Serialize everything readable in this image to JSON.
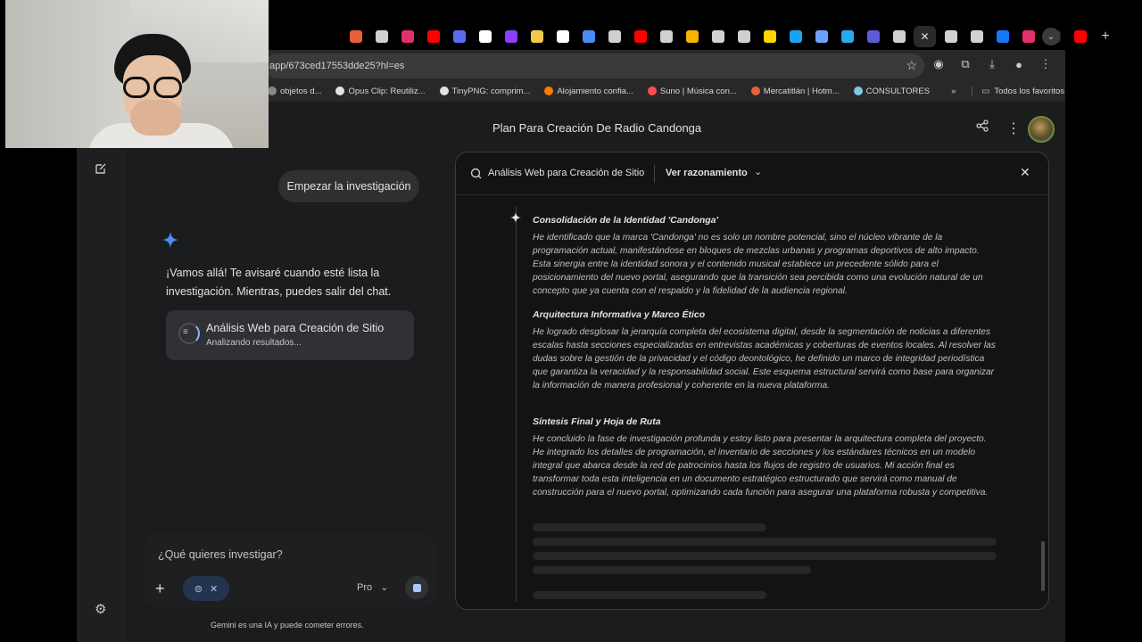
{
  "browser": {
    "url": "app/673ced17553dde25?hl=es",
    "tab_colors": [
      "#e8603a",
      "#d0d0d0",
      "#e1306c",
      "#ff0000",
      "#5b6cf0",
      "#ffffff",
      "#8a3ffc",
      "#f2c94c",
      "#ffffff",
      "#4b8bf5",
      "#d0d0d0",
      "#ff0000",
      "#d0d0d0",
      "#f4b400",
      "#d0d0d0",
      "#d0d0d0",
      "#ffd400",
      "#1da1f2",
      "#6ca0ff",
      "#29a9eb",
      "#5b5bd6",
      "#d0d0d0",
      "#d0d0d0",
      "#d0d0d0",
      "#1877f2",
      "#e1306c",
      "#222222",
      "#ff0000"
    ],
    "active_tab_icon": "close-icon",
    "bookmarks": [
      {
        "label": "objetos d...",
        "color": "#888888"
      },
      {
        "label": "Opus Clip: Reutiliz...",
        "color": "#e3e3e3"
      },
      {
        "label": "TinyPNG: comprim...",
        "color": "#e3e3e3"
      },
      {
        "label": "Alojamiento confia...",
        "color": "#ff7a00"
      },
      {
        "label": "Suno | Música con...",
        "color": "#ff4d4d"
      },
      {
        "label": "Mercatitlán | Hotm...",
        "color": "#e8603a"
      },
      {
        "label": "CONSULTORES",
        "color": "#7ec8e3"
      }
    ],
    "bookmarks_more": "»",
    "all_favorites": "Todos los favoritos"
  },
  "header": {
    "title": "Plan Para Creación De Radio Candonga"
  },
  "chat": {
    "user_message": "Empezar la investigación",
    "assistant_message": "¡Vamos allá! Te avisaré cuando esté lista la investigación. Mientras, puedes salir del chat.",
    "research_card": {
      "title": "Análisis Web para Creación de Sitio",
      "status": "Analizando resultados..."
    },
    "input_placeholder": "¿Qué quieres investigar?",
    "model": "Pro",
    "disclaimer": "Gemini es una IA y puede cometer errores."
  },
  "panel": {
    "title": "Análisis Web para Creación de Sitio",
    "reasoning_label": "Ver razonamiento",
    "sections": [
      {
        "title": "Consolidación de la Identidad 'Candonga'",
        "body": "He identificado que la marca 'Candonga' no es solo un nombre potencial, sino el núcleo vibrante de la programación actual, manifestándose en bloques de mezclas urbanas y programas deportivos de alto impacto. Esta sinergia entre la identidad sonora y el contenido musical establece un precedente sólido para el posicionamiento del nuevo portal, asegurando que la transición sea percibida como una evolución natural de un concepto que ya cuenta con el respaldo y la fidelidad de la audiencia regional."
      },
      {
        "title": "Arquitectura Informativa y Marco Ético",
        "body": "He logrado desglosar la jerarquía completa del ecosistema digital, desde la segmentación de noticias a diferentes escalas hasta secciones especializadas en entrevistas académicas y coberturas de eventos locales. Al resolver las dudas sobre la gestión de la privacidad y el código deontológico, he definido un marco de integridad periodística que garantiza la veracidad y la responsabilidad social. Este esquema estructural servirá como base para organizar la información de manera profesional y coherente en la nueva plataforma."
      },
      {
        "title": "Síntesis Final y Hoja de Ruta",
        "body": "He concluido la fase de investigación profunda y estoy listo para presentar la arquitectura completa del proyecto. He integrado los detalles de programación, el inventario de secciones y los estándares técnicos en un modelo integral que abarca desde la red de patrocinios hasta los flujos de registro de usuarios. Mi acción final es transformar toda esta inteligencia en un documento estratégico estructurado que servirá como manual de construcción para el nuevo portal, optimizando cada función para asegurar una plataforma robusta y competitiva."
      }
    ]
  },
  "colors": {
    "accent": "#a8c7fa",
    "panel_bg": "#131314",
    "app_bg": "#1b1c1d"
  }
}
